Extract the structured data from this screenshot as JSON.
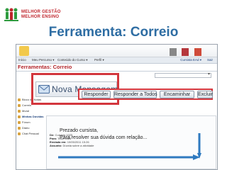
{
  "brand": {
    "line1": "MELHOR GESTÃO",
    "line2": "MELHOR ENSINO",
    "logo_icon": "people-logo-icon"
  },
  "slide": {
    "title": "Ferramenta: Correio"
  },
  "app": {
    "menu": [
      "Início",
      "Meu Percurso ▾",
      "Conteúdo do Curso ▾",
      "Perfil ▾"
    ],
    "user": "Cursista EAd ▾",
    "logout": "Sair",
    "section_title": "Ferramentas: Correio",
    "sidebar": [
      "Bloco de Notas",
      "Correio",
      "Mural",
      "Minhas Dúvidas",
      "Fórum",
      "Diário",
      "Chat Pessoal"
    ],
    "sidebar_active_index": 3,
    "new_message": "Nova Mensagem",
    "buttons": {
      "responder": "Responder",
      "responder_todos": "Responder a Todos",
      "encaminhar": "Encaminhar",
      "excluir": "Excluir"
    },
    "message_meta": [
      {
        "label": "De:",
        "value": "Cursista 1025"
      },
      {
        "label": "Para:",
        "value": "Tutor 0025"
      },
      {
        "label": "Enviada em:",
        "value": "10/05/2011 15:26"
      },
      {
        "label": "Assunto:",
        "value": "Dúvida sobre a atividade"
      }
    ],
    "body_line1": "Prezado cursista,",
    "body_line2": "Para resolver sua dúvida com relação..."
  },
  "colors": {
    "title": "#2e6da3",
    "highlight": "#d3363d",
    "brand": "#c0262d",
    "arrow": "#2f7ac0"
  }
}
